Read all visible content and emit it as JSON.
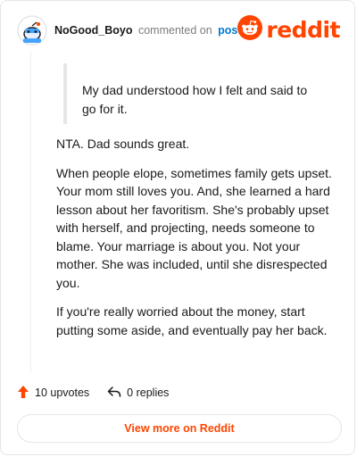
{
  "header": {
    "username": "NoGood_Boyo",
    "action_text": "commented on",
    "post_link": "post",
    "brand": "reddit",
    "avatar_icon": "snoo-avatar-icon",
    "brand_icon": "reddit-snoo-logo-icon"
  },
  "quote": {
    "text": "My dad understood how I felt and said to go for it."
  },
  "comment": {
    "paragraphs": [
      "NTA. Dad sounds great.",
      "When people elope, sometimes family gets upset. Your mom still loves you. And, she learned a hard lesson about her favoritism. She's probably upset with herself, and projecting, needs someone to blame. Your marriage is about you. Not your mother. She was included, until she disrespected you.",
      "If you're really worried about the money, start putting some aside, and eventually pay her back."
    ]
  },
  "actions": {
    "upvotes": "10 upvotes",
    "replies": "0 replies",
    "upvote_icon": "upvote-arrow-icon",
    "reply_icon": "reply-arrow-icon"
  },
  "footer": {
    "view_more": "View more on Reddit"
  },
  "colors": {
    "brand": "#ff4500",
    "link": "#0079d3",
    "text": "#1a1a1b",
    "muted": "#7c7c7c",
    "border": "#e4e6e8"
  }
}
